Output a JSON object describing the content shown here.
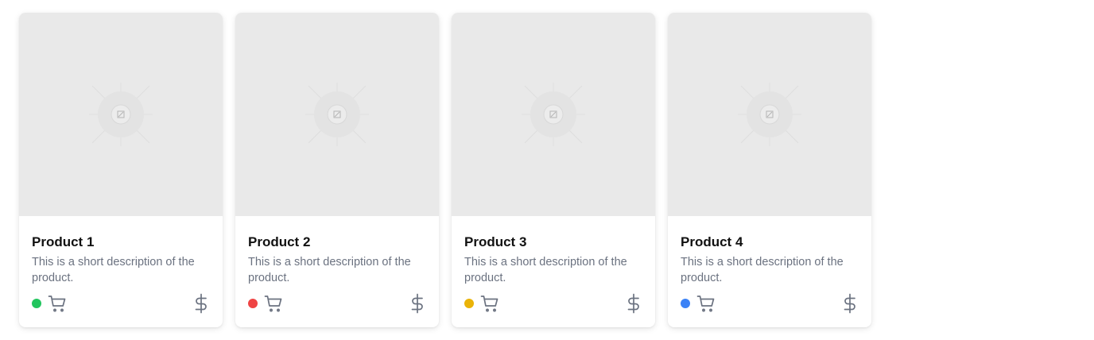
{
  "products": [
    {
      "title": "Product 1",
      "description": "This is a short description of the product.",
      "status_color": "#22c55e",
      "image_icon": "image-placeholder-icon",
      "cart_icon": "cart-icon",
      "price_icon": "dollar-icon"
    },
    {
      "title": "Product 2",
      "description": "This is a short description of the product.",
      "status_color": "#ef4444",
      "image_icon": "image-placeholder-icon",
      "cart_icon": "cart-icon",
      "price_icon": "dollar-icon"
    },
    {
      "title": "Product 3",
      "description": "This is a short description of the product.",
      "status_color": "#eab308",
      "image_icon": "image-placeholder-icon",
      "cart_icon": "cart-icon",
      "price_icon": "dollar-icon"
    },
    {
      "title": "Product 4",
      "description": "This is a short description of the product.",
      "status_color": "#3b82f6",
      "image_icon": "image-placeholder-icon",
      "cart_icon": "cart-icon",
      "price_icon": "dollar-icon"
    }
  ],
  "colors": {
    "icon_gray": "#6b7280",
    "placeholder_bg": "#e9e9e9"
  }
}
